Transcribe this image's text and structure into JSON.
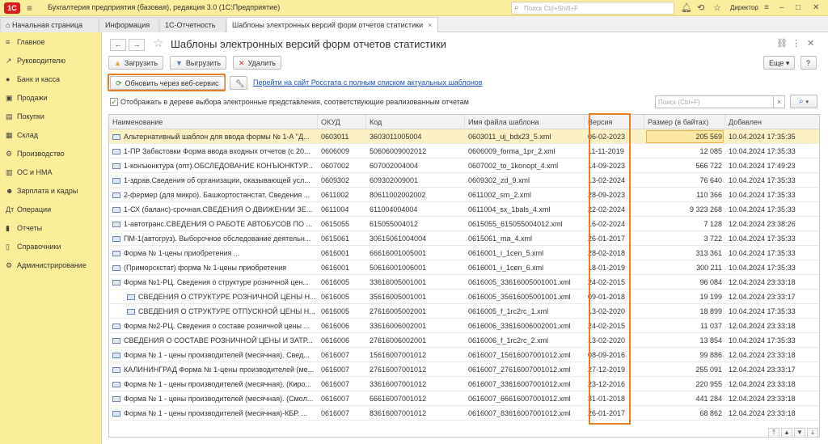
{
  "app": {
    "logo": "1С",
    "title": "Бухгалтерия предприятия (базовая), редакция 3.0  (1С:Предприятие)",
    "search_placeholder": "Поиск Ctrl+Shift+F",
    "user": "Директор"
  },
  "tabs": [
    {
      "label": "Начальная страница"
    },
    {
      "label": "Информация"
    },
    {
      "label": "1С-Отчетность"
    },
    {
      "label": "Шаблоны электронных версий форм отчетов статистики"
    }
  ],
  "sidebar": {
    "items": [
      {
        "label": "Главное",
        "icon": "≡"
      },
      {
        "label": "Руководителю",
        "icon": "↗"
      },
      {
        "label": "Банк и касса",
        "icon": "●"
      },
      {
        "label": "Продажи",
        "icon": "▣"
      },
      {
        "label": "Покупки",
        "icon": "▤"
      },
      {
        "label": "Склад",
        "icon": "▦"
      },
      {
        "label": "Производство",
        "icon": "⚙"
      },
      {
        "label": "ОС и НМА",
        "icon": "▥"
      },
      {
        "label": "Зарплата и кадры",
        "icon": "☻"
      },
      {
        "label": "Операции",
        "icon": "Дт"
      },
      {
        "label": "Отчеты",
        "icon": "▮"
      },
      {
        "label": "Справочники",
        "icon": "▯"
      },
      {
        "label": "Администрирование",
        "icon": "⚙"
      }
    ]
  },
  "page": {
    "title": "Шаблоны электронных версий форм отчетов статистики",
    "more_label": "Еще",
    "help_label": "?"
  },
  "toolbar": {
    "load": "Загрузить",
    "unload": "Выгрузить",
    "delete": "Удалить",
    "update_web": "Обновить через веб-сервис",
    "rosstat_link": "Перейти на сайт Росстата с полным списком актуальных шаблонов",
    "checkbox_label": "Отображать в дереве выбора электронные представления, соответствующие реализованным отчетам",
    "search_placeholder": "Поиск (Ctrl+F)"
  },
  "table": {
    "columns": [
      "Наименование",
      "ОКУД",
      "Код",
      "Имя файла шаблона",
      "Версия",
      "Размер (в байтах)",
      "Добавлен"
    ],
    "rows": [
      {
        "name": "Альтернативный шаблон для ввода формы № 1-А \"Д...",
        "okud": "0603011",
        "code": "3603011005004",
        "file": "0603011_uj_bdx23_5.xml",
        "version": "06-02-2023",
        "size": "205 569",
        "added": "10.04.2024 17:35:35",
        "indent": 0
      },
      {
        "name": "1-ПР Забастовки Форма ввода входных отчетов (с 20...",
        "okud": "0606009",
        "code": "50606009002012",
        "file": "0606009_forma_1pr_2.xml",
        "version": "11-11-2019",
        "size": "12 085",
        "added": "10.04.2024 17:35:33",
        "indent": 0
      },
      {
        "name": "1-конъюнктура (опт).ОБСЛЕДОВАНИЕ КОНЪЮНКТУР...",
        "okud": "0607002",
        "code": "607002004004",
        "file": "0607002_to_1konopt_4.xml",
        "version": "14-09-2023",
        "size": "566 722",
        "added": "10.04.2024 17:49:23",
        "indent": 0
      },
      {
        "name": "1-здрав.Сведения об организации, оказывающей усл...",
        "okud": "0609302",
        "code": "609302009001",
        "file": "0609302_zd_9.xml",
        "version": "13-02-2024",
        "size": "76 640",
        "added": "10.04.2024 17:35:33",
        "indent": 0
      },
      {
        "name": "2-фермер (для микро). Башкортостанстат. Сведения ...",
        "okud": "0611002",
        "code": "80611002002002",
        "file": "0611002_sm_2.xml",
        "version": "28-09-2023",
        "size": "110 366",
        "added": "10.04.2024 17:35:33",
        "indent": 0
      },
      {
        "name": "1-СХ (баланс)-срочная.СВЕДЕНИЯ О ДВИЖЕНИИ ЗЕ...",
        "okud": "0611004",
        "code": "611004004004",
        "file": "0611004_sx_1bals_4.xml",
        "version": "22-02-2024",
        "size": "9 323 268",
        "added": "10.04.2024 17:35:33",
        "indent": 0
      },
      {
        "name": "1-автотранс.СВЕДЕНИЯ О РАБОТЕ АВТОБУСОВ ПО ...",
        "okud": "0615055",
        "code": "615055004012",
        "file": "0615055_615055004012.xml",
        "version": "16-02-2024",
        "size": "7 128",
        "added": "12.04.2024 23:38:26",
        "indent": 0
      },
      {
        "name": "ПМ-1(автогруз). Выборочное обследование деятельн...",
        "okud": "0615061",
        "code": "30615061004004",
        "file": "0615061_ma_4.xml",
        "version": "26-01-2017",
        "size": "3 722",
        "added": "10.04.2024 17:35:33",
        "indent": 0
      },
      {
        "name": "Форма № 1-цены приобретения ...",
        "okud": "0616001",
        "code": "66616001005001",
        "file": "0616001_i_1cen_5.xml",
        "version": "28-02-2018",
        "size": "313 361",
        "added": "10.04.2024 17:35:33",
        "indent": 0
      },
      {
        "name": "(Приморскстат) форма № 1-цены приобретения",
        "okud": "0616001",
        "code": "50616001006001",
        "file": "0616001_i_1cen_6.xml",
        "version": "18-01-2019",
        "size": "300 211",
        "added": "10.04.2024 17:35:33",
        "indent": 0
      },
      {
        "name": "Форма №1-РЦ. Сведения о структуре розничной цен...",
        "okud": "0616005",
        "code": "33616005001001",
        "file": "0616005_33616005001001.xml",
        "version": "24-02-2015",
        "size": "96 084",
        "added": "12.04.2024 23:33:18",
        "indent": 0
      },
      {
        "name": "СВЕДЕНИЯ О СТРУКТУРЕ РОЗНИЧНОЙ ЦЕНЫ Н...",
        "okud": "0616005",
        "code": "35616005001001",
        "file": "0616005_35616005001001.xml",
        "version": "09-01-2018",
        "size": "19 199",
        "added": "12.04.2024 23:33:17",
        "indent": 1
      },
      {
        "name": "СВЕДЕНИЯ О СТРУКТУРЕ ОТПУСКНОЙ ЦЕНЫ Н...",
        "okud": "0616005",
        "code": "27616005002001",
        "file": "0616005_f_1rc2rc_1.xml",
        "version": "13-02-2020",
        "size": "18 899",
        "added": "10.04.2024 17:35:33",
        "indent": 1
      },
      {
        "name": "Форма №2-РЦ. Сведения о составе розничной цены ...",
        "okud": "0616006",
        "code": "33616006002001",
        "file": "0616006_33616006002001.xml",
        "version": "24-02-2015",
        "size": "11 037",
        "added": "12.04.2024 23:33:18",
        "indent": 0
      },
      {
        "name": "СВЕДЕНИЯ О СОСТАВЕ РОЗНИЧНОЙ ЦЕНЫ И ЗАТР...",
        "okud": "0616006",
        "code": "27616006002001",
        "file": "0616006_f_1rc2rc_2.xml",
        "version": "13-02-2020",
        "size": "13 854",
        "added": "10.04.2024 17:35:33",
        "indent": 0
      },
      {
        "name": "Форма № 1 - цены производителей (месячная). Свед...",
        "okud": "0616007",
        "code": "15616007001012",
        "file": "0616007_15616007001012.xml",
        "version": "08-09-2016",
        "size": "99 886",
        "added": "12.04.2024 23:33:18",
        "indent": 0
      },
      {
        "name": "КАЛИНИНГРАД Форма № 1-цены производителей (ме...",
        "okud": "0616007",
        "code": "27616007001012",
        "file": "0616007_27616007001012.xml",
        "version": "27-12-2019",
        "size": "255 091",
        "added": "12.04.2024 23:33:17",
        "indent": 0
      },
      {
        "name": "Форма № 1 - цены производителей (месячная). (Киро...",
        "okud": "0616007",
        "code": "33616007001012",
        "file": "0616007_33616007001012.xml",
        "version": "23-12-2016",
        "size": "220 955",
        "added": "12.04.2024 23:33:18",
        "indent": 0
      },
      {
        "name": "Форма № 1 - цены производителей (месячная). (Смол...",
        "okud": "0616007",
        "code": "66616007001012",
        "file": "0616007_66616007001012.xml",
        "version": "31-01-2018",
        "size": "441 284",
        "added": "12.04.2024 23:33:18",
        "indent": 0
      },
      {
        "name": "Форма № 1 - цены производителей (месячная)-КБР. ...",
        "okud": "0616007",
        "code": "83616007001012",
        "file": "0616007_83616007001012.xml",
        "version": "26-01-2017",
        "size": "68 862",
        "added": "12.04.2024 23:33:18",
        "indent": 0
      }
    ]
  },
  "colors": {
    "sidebar_bg": "#fbee9b",
    "highlight": "#e87d23",
    "selected_row": "#fbf1c5",
    "link": "#1d55b5",
    "logo": "#d91e1e"
  }
}
